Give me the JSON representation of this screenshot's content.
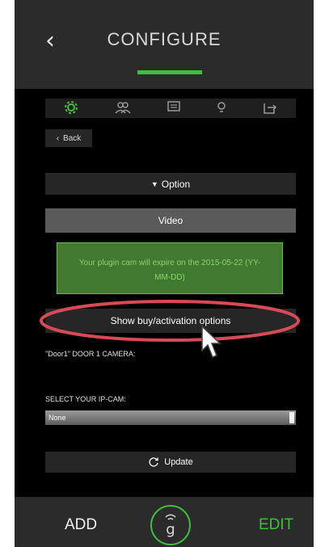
{
  "header": {
    "title": "CONFIGURE",
    "back_icon": "chevron-left-icon"
  },
  "tabs": [
    {
      "name": "settings-gear",
      "active": true
    },
    {
      "name": "users"
    },
    {
      "name": "messages"
    },
    {
      "name": "lightbulb"
    },
    {
      "name": "export"
    }
  ],
  "back_button": {
    "label": "Back"
  },
  "option_bar": {
    "label": "Option",
    "icon": "triangle-down-icon"
  },
  "video_bar": {
    "label": "Video"
  },
  "expire_notice": {
    "text": "Your plugin cam will expire on the 2015-05-22 (YY-MM-DD)"
  },
  "show_button": {
    "label": "Show buy/activation options"
  },
  "camera_label": "\"Door1\" DOOR 1 CAMERA:",
  "select_section": {
    "label": "SELECT YOUR IP-CAM:",
    "value": "None"
  },
  "update_button": {
    "label": "Update"
  },
  "footer": {
    "add_label": "ADD",
    "edit_label": "EDIT",
    "logo_letter": "g"
  },
  "colors": {
    "accent": "#3fbf3f",
    "annotation": "#d94a57",
    "bg": "#000000"
  }
}
